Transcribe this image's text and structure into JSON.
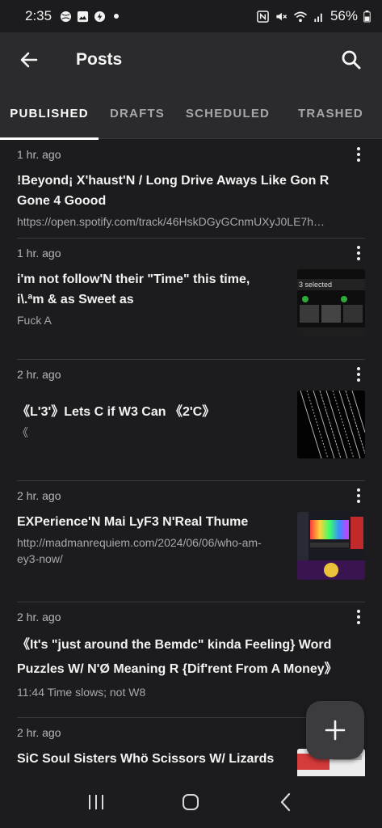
{
  "status_bar": {
    "time": "2:35",
    "battery": "56%",
    "left_icons": [
      "ball-icon",
      "image-icon",
      "bolt-icon"
    ],
    "right_icons": [
      "nfc-icon",
      "mute-icon",
      "wifi-icon",
      "signal-icon",
      "battery-icon"
    ]
  },
  "appbar": {
    "title": "Posts"
  },
  "tabs": [
    {
      "label": "PUBLISHED",
      "active": true
    },
    {
      "label": "DRAFTS",
      "active": false
    },
    {
      "label": "SCHEDULED",
      "active": false
    },
    {
      "label": "TRASHED",
      "active": false
    }
  ],
  "posts": [
    {
      "time": "1 hr. ago",
      "title": "!Beyond¡ X'haust'N / Long Drive Aways Like Gon R Gone 4 Goood",
      "subtitle": "https://open.spotify.com/track/46HskDGyGCnmUXyJ0LE7h…"
    },
    {
      "time": "1 hr. ago",
      "title": "i'm not follow'N their \"Time\" this time, i\\.ªm & as Sweet as",
      "subtitle": "Fuck A",
      "thumb_text": "3 selected"
    },
    {
      "time": "2 hr. ago",
      "title": "《L'3'》Lets C if W3 Can 《2'C》",
      "subtitle": "《"
    },
    {
      "time": "2 hr. ago",
      "title": "EXPerience'N Mai LyF3 N'Real Thume",
      "subtitle": "http://madmanrequiem.com/2024/06/06/who-am-ey3-now/"
    },
    {
      "time": "2 hr. ago",
      "title": "《It's \"just around the Bemdc\" kinda Feeling} Word Puzzles W/ N'Ø Meaning R {Dif'rent From A Money》",
      "subtitle": "11:44 Time slows; not W8"
    },
    {
      "time": "2 hr. ago",
      "title": "SiC Soul Sisters Whö Scissors W/ Lizards"
    }
  ],
  "fab": {
    "icon": "plus-icon"
  },
  "nav": {
    "icons": [
      "recents-icon",
      "home-icon",
      "back-nav-icon"
    ]
  },
  "colors": {
    "background": "#1c1c1e",
    "appbar": "#2b2b2d",
    "accent": "#ffffff",
    "fab": "#3c3c3f"
  }
}
